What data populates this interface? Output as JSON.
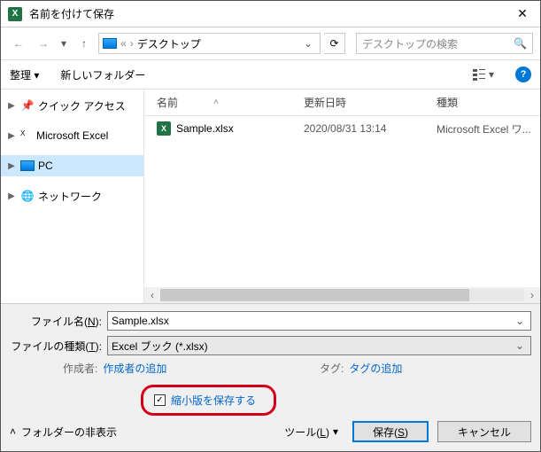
{
  "titlebar": {
    "title": "名前を付けて保存"
  },
  "navbar": {
    "path_sep": "«",
    "path_arrow": "›",
    "location": "デスクトップ",
    "search_placeholder": "デスクトップの検索"
  },
  "toolbar": {
    "organize": "整理",
    "new_folder": "新しいフォルダー"
  },
  "sidebar": {
    "quick": "クイック アクセス",
    "excel": "Microsoft Excel",
    "pc": "PC",
    "network": "ネットワーク"
  },
  "columns": {
    "name": "名前",
    "date": "更新日時",
    "type": "種類"
  },
  "files": [
    {
      "name": "Sample.xlsx",
      "date": "2020/08/31 13:14",
      "type": "Microsoft Excel ワ..."
    }
  ],
  "fields": {
    "filename_label": "ファイル名(N):",
    "filename_value": "Sample.xlsx",
    "filetype_label": "ファイルの種類(T):",
    "filetype_value": "Excel ブック (*.xlsx)"
  },
  "meta": {
    "author_label": "作成者:",
    "author_value": "作成者の追加",
    "tag_label": "タグ:",
    "tag_value": "タグの追加"
  },
  "thumbnail": {
    "label": "縮小版を保存する",
    "checked": true
  },
  "buttons": {
    "hide_folders": "フォルダーの非表示",
    "tools": "ツール(L)",
    "save": "保存(S)",
    "cancel": "キャンセル"
  }
}
